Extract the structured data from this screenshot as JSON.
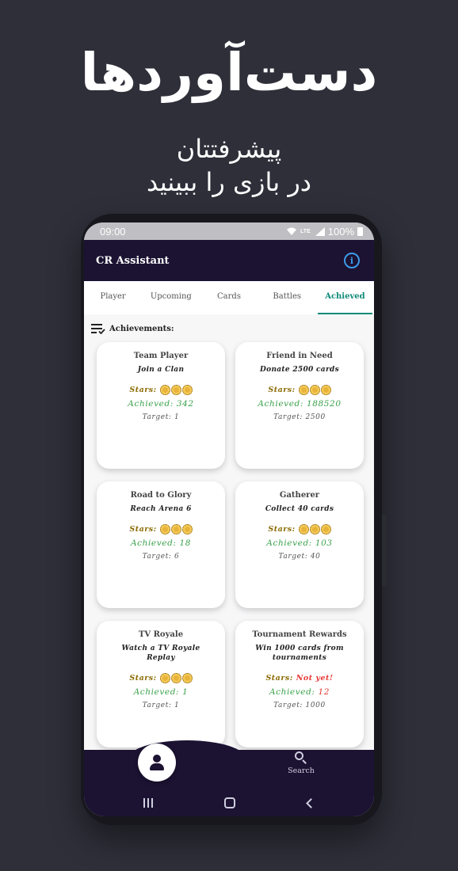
{
  "promo": {
    "headline": "دست‌آوردها",
    "line1": "پیشرفتتان",
    "line2": "در بازی را ببینید"
  },
  "statusbar": {
    "time": "09:00",
    "network": "LTE",
    "battery": "100%"
  },
  "app": {
    "title": "CR Assistant"
  },
  "tabs": [
    "Player",
    "Upcoming",
    "Cards",
    "Battles",
    "Achieved"
  ],
  "active_tab": "Achieved",
  "section": {
    "title": "Achievements:"
  },
  "labels": {
    "stars": "Stars:",
    "achieved": "Achieved:",
    "target": "Target:"
  },
  "cards": [
    {
      "title": "Team Player",
      "desc": "Join a Clan",
      "stars": 3,
      "achieved": "342",
      "target": "1"
    },
    {
      "title": "Friend in Need",
      "desc": "Donate 2500 cards",
      "stars": 3,
      "achieved": "188520",
      "target": "2500"
    },
    {
      "title": "Road to Glory",
      "desc": "Reach Arena 6",
      "stars": 3,
      "achieved": "18",
      "target": "6"
    },
    {
      "title": "Gatherer",
      "desc": "Collect 40 cards",
      "stars": 3,
      "achieved": "103",
      "target": "40"
    },
    {
      "title": "TV Royale",
      "desc": "Watch a TV Royale Replay",
      "stars": 3,
      "achieved": "1",
      "target": "1"
    },
    {
      "title": "Tournament Rewards",
      "desc": "Win 1000 cards from tournaments",
      "stars": 0,
      "not_yet": "Not yet!",
      "achieved": "12",
      "target": "1000"
    }
  ],
  "bottomnav": {
    "search_label": "Search"
  },
  "colors": {
    "app_bar": "#1c1232",
    "accent": "#0f8a78",
    "achieved": "#3aa14a",
    "not_yet": "#e53935",
    "background": "#2f2f3a"
  }
}
